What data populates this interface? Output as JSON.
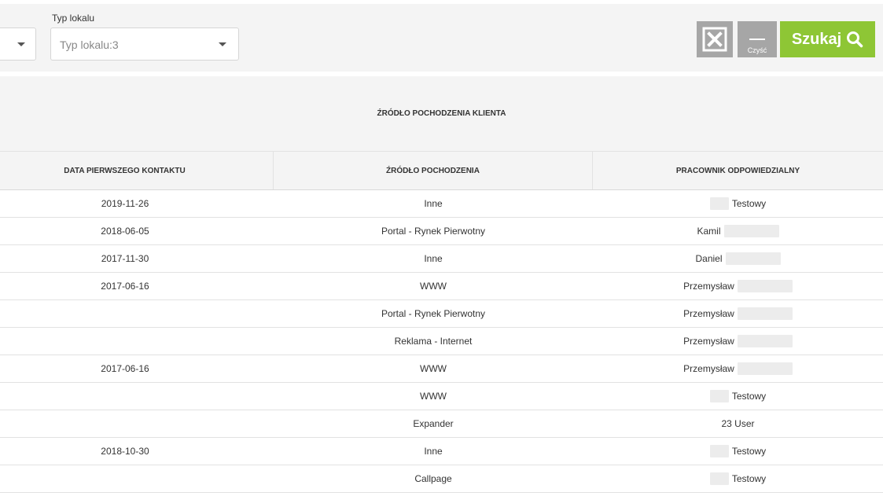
{
  "filters": {
    "type_label": "Typ lokalu",
    "type_value": "Typ lokalu:3"
  },
  "buttons": {
    "clear_label": "Czyść",
    "search_label": "Szukaj"
  },
  "table": {
    "group_header": "ŹRÓDŁO POCHODZENIA KLIENTA",
    "columns": [
      "DATA PIERWSZEGO KONTAKTU",
      "ŹRÓDŁO POCHODZENIA",
      "PRACOWNIK ODPOWIEDZIALNY"
    ],
    "rows": [
      {
        "date": "2019-11-26",
        "source": "Inne",
        "employee": "Testowy",
        "redaction": "pre"
      },
      {
        "date": "2018-06-05",
        "source": "Portal - Rynek Pierwotny",
        "employee": "Kamil",
        "redaction": "post"
      },
      {
        "date": "2017-11-30",
        "source": "Inne",
        "employee": "Daniel",
        "redaction": "post"
      },
      {
        "date": "2017-06-16",
        "source": "WWW",
        "employee": "Przemysław",
        "redaction": "post"
      },
      {
        "date": "",
        "source": "Portal - Rynek Pierwotny",
        "employee": "Przemysław",
        "redaction": "post"
      },
      {
        "date": "",
        "source": "Reklama - Internet",
        "employee": "Przemysław",
        "redaction": "post"
      },
      {
        "date": "2017-06-16",
        "source": "WWW",
        "employee": "Przemysław",
        "redaction": "post"
      },
      {
        "date": "",
        "source": "WWW",
        "employee": "Testowy",
        "redaction": "pre"
      },
      {
        "date": "",
        "source": "Expander",
        "employee": "23 User",
        "redaction": "none"
      },
      {
        "date": "2018-10-30",
        "source": "Inne",
        "employee": "Testowy",
        "redaction": "pre"
      },
      {
        "date": "",
        "source": "Callpage",
        "employee": "Testowy",
        "redaction": "pre"
      }
    ]
  },
  "icons": {
    "excel": "excel-export-icon",
    "clear": "clear-icon",
    "search": "search-icon",
    "dropdown": "chevron-down-icon"
  },
  "colors": {
    "search_button": "#8ec635",
    "gray_button": "#a6a6a6",
    "header_bg": "#f4f4f4"
  }
}
